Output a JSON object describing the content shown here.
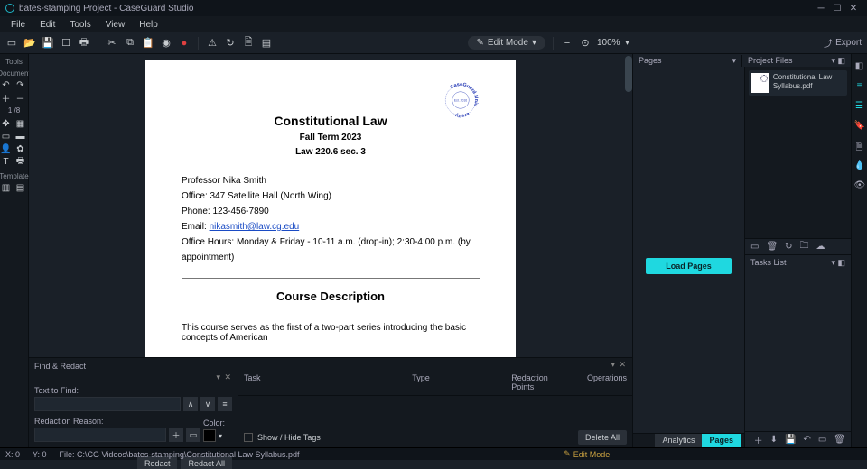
{
  "window": {
    "title": "bates-stamping Project - CaseGuard Studio"
  },
  "menu": [
    "File",
    "Edit",
    "Tools",
    "View",
    "Help"
  ],
  "toolbar": {
    "mode_label": "Edit Mode",
    "zoom": "100%",
    "export": "Export"
  },
  "left": {
    "tools_label": "Tools",
    "doc_label": "Document",
    "page_indicator": "1 /8",
    "template_label": "Template"
  },
  "document": {
    "seal_top": "CaseGuard Univ",
    "seal_bottom": "ersity",
    "seal_est": "Est. 2016",
    "title": "Constitutional Law",
    "term": "Fall Term 2023",
    "course": "Law 220.6 sec. 3",
    "prof": "Professor Nika Smith",
    "office": "Office: 347 Satellite Hall (North Wing)",
    "phone": "Phone: 123-456-7890",
    "email_label": "Email: ",
    "email_link": "nikasmith@law.cg.edu",
    "hours": "Office Hours: Monday & Friday - 10-11 a.m. (drop-in); 2:30-4:00 p.m. (by appointment)",
    "section": "Course Description",
    "para": "This course serves as the first of a two-part series introducing the basic concepts of American"
  },
  "find": {
    "header": "Find & Redact",
    "text_to_find": "Text to Find:",
    "reason": "Redaction Reason:",
    "color": "Color:",
    "redact": "Redact",
    "redact_all": "Redact All",
    "show_hide": "Show / Hide Tags",
    "delete_all": "Delete All",
    "cols": {
      "task": "Task",
      "type": "Type",
      "points": "Redaction Points",
      "ops": "Operations"
    }
  },
  "right": {
    "pages_tab": "Pages",
    "files_tab": "Project Files",
    "load_pages": "Load Pages",
    "file_name": "Constitutional Law Syllabus.pdf",
    "tasks_label": "Tasks List",
    "tabs": {
      "analytics": "Analytics",
      "pages": "Pages"
    }
  },
  "status": {
    "x": "X: 0",
    "y": "Y: 0",
    "file": "File: C:\\CG Videos\\bates-stamping\\Constitutional Law Syllabus.pdf",
    "mode": "Edit Mode"
  }
}
